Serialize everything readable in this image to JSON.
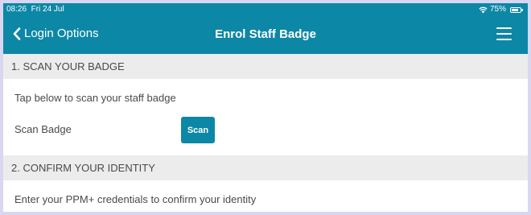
{
  "status_bar": {
    "time": "08:26",
    "date": "Fri 24 Jul",
    "battery_percent": "75%",
    "icons": [
      "wifi-icon",
      "battery-icon"
    ]
  },
  "nav": {
    "back_label": "Login Options",
    "title": "Enrol Staff Badge",
    "menu_icon": "hamburger-menu-icon"
  },
  "sections": {
    "scan": {
      "header": "1. SCAN YOUR BADGE",
      "instruction": "Tap below to scan your staff badge",
      "row_label": "Scan Badge",
      "button_label": "Scan"
    },
    "confirm": {
      "header": "2. CONFIRM YOUR IDENTITY",
      "instruction": "Enter your PPM+ credentials to confirm your identity"
    }
  },
  "colors": {
    "accent": "#0d87a6",
    "section_bg": "#ececec",
    "text": "#4a4a4a",
    "outer_bg": "#d9d6f2"
  }
}
